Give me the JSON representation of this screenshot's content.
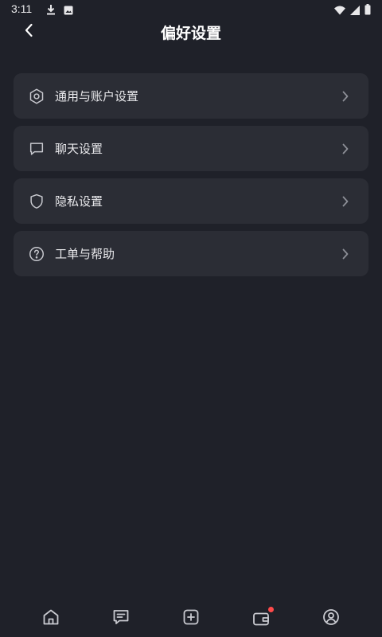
{
  "status_bar": {
    "time": "3:11"
  },
  "header": {
    "title": "偏好设置"
  },
  "menu": {
    "items": [
      {
        "label": "通用与账户设置",
        "icon": "gear-icon"
      },
      {
        "label": "聊天设置",
        "icon": "chat-bubble-icon"
      },
      {
        "label": "隐私设置",
        "icon": "shield-icon"
      },
      {
        "label": "工单与帮助",
        "icon": "help-circle-icon"
      }
    ]
  },
  "bottom_nav": {
    "items": [
      {
        "name": "home",
        "icon": "home-icon"
      },
      {
        "name": "messages",
        "icon": "message-icon"
      },
      {
        "name": "create",
        "icon": "plus-square-icon"
      },
      {
        "name": "wallet",
        "icon": "wallet-icon",
        "has_notification": true
      },
      {
        "name": "profile",
        "icon": "profile-icon"
      }
    ]
  },
  "colors": {
    "background": "#1f2129",
    "card": "#2b2d35",
    "text": "#e9e9ec",
    "icon": "#c9cad0",
    "chevron": "#8d8f97",
    "notification": "#ff4a4a"
  }
}
